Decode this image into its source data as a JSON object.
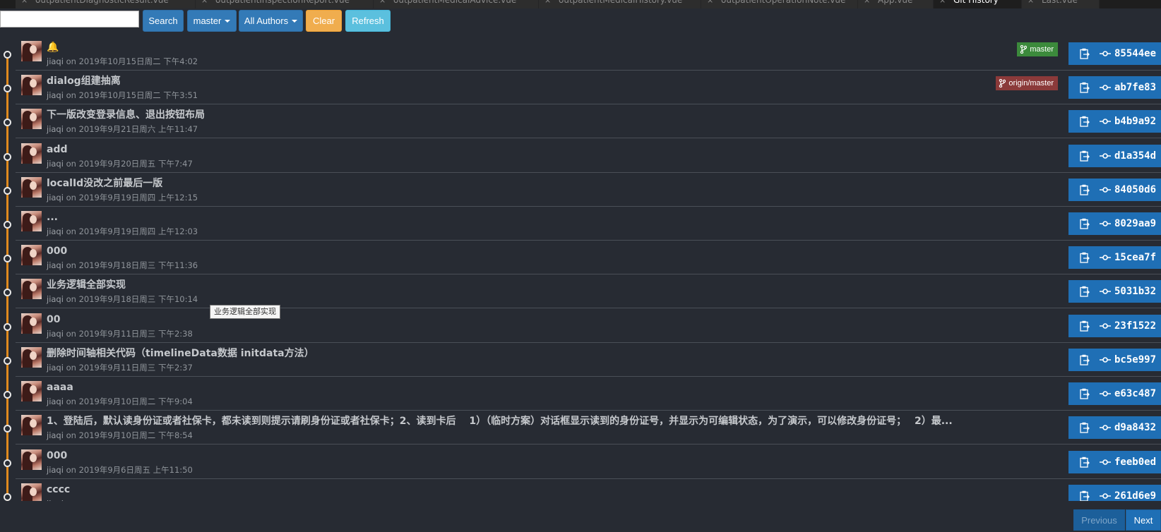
{
  "tabs": [
    {
      "label": "outpatientDiagnosticResult.vue",
      "active": false
    },
    {
      "label": "outpatientInspectionReport.vue",
      "active": false
    },
    {
      "label": "outpatientMedicalAdvice.vue",
      "active": false
    },
    {
      "label": "outpatientMedicalHistory.vue",
      "active": false
    },
    {
      "label": "outpatientOperationNote.vue",
      "active": false
    },
    {
      "label": "App.vue",
      "active": false
    },
    {
      "label": "Git History",
      "active": true
    },
    {
      "label": "Last.vue",
      "active": false
    }
  ],
  "toolbar": {
    "search_value": "",
    "search_label": "Search",
    "branch_label": "master",
    "authors_label": "All Authors",
    "clear_label": "Clear",
    "refresh_label": "Refresh"
  },
  "commits": [
    {
      "subject": "🔔",
      "author": "jiaqi",
      "on": "on",
      "date": "2019年10月15日周二 下午4:02",
      "sha": "85544ee",
      "branch": "master",
      "branch_color": "#3c8a3c"
    },
    {
      "subject": "dialog组建抽离",
      "author": "jiaqi",
      "on": "on",
      "date": "2019年10月15日周二 下午3:51",
      "sha": "ab7fe83",
      "branch": "origin/master",
      "branch_color": "#8b3a3a"
    },
    {
      "subject": "下一版改变登录信息、退出按钮布局",
      "author": "jiaqi",
      "on": "on",
      "date": "2019年9月21日周六 上午11:47",
      "sha": "b4b9a92"
    },
    {
      "subject": "add",
      "author": "jiaqi",
      "on": "on",
      "date": "2019年9月20日周五 下午7:47",
      "sha": "d1a354d"
    },
    {
      "subject": "localId没改之前最后一版",
      "author": "jiaqi",
      "on": "on",
      "date": "2019年9月19日周四 上午12:15",
      "sha": "84050d6"
    },
    {
      "subject": "...",
      "author": "jiaqi",
      "on": "on",
      "date": "2019年9月19日周四 上午12:03",
      "sha": "8029aa9"
    },
    {
      "subject": "000",
      "author": "jiaqi",
      "on": "on",
      "date": "2019年9月18日周三 下午11:36",
      "sha": "15cea7f"
    },
    {
      "subject": "业务逻辑全部实现",
      "author": "jiaqi",
      "on": "on",
      "date": "2019年9月18日周三 下午10:14",
      "sha": "5031b32"
    },
    {
      "subject": "00",
      "author": "jiaqi",
      "on": "on",
      "date": "2019年9月11日周三 下午2:38",
      "sha": "23f1522"
    },
    {
      "subject": "删除时间轴相关代码（timelineData数据 initdata方法）",
      "author": "jiaqi",
      "on": "on",
      "date": "2019年9月11日周三 下午2:37",
      "sha": "bc5e997"
    },
    {
      "subject": "aaaa",
      "author": "jiaqi",
      "on": "on",
      "date": "2019年9月10日周二 下午9:04",
      "sha": "e63c487"
    },
    {
      "subject": "1、登陆后，默认读身份证或者社保卡，都未读到则提示请刷身份证或者社保卡；2、读到卡后　 1）（临时方案）对话框显示读到的身份证号，并显示为可编辑状态，为了演示，可以修改身份证号；　 2）最...",
      "author": "jiaqi",
      "on": "on",
      "date": "2019年9月10日周二 下午8:54",
      "sha": "d9a8432"
    },
    {
      "subject": "000",
      "author": "jiaqi",
      "on": "on",
      "date": "2019年9月6日周五 上午11:50",
      "sha": "feeb0ed"
    },
    {
      "subject": "cccc",
      "author": "jiaqi",
      "on": "on",
      "date": "",
      "sha": "261d6e9"
    }
  ],
  "tooltip": "业务逻辑全部实现",
  "pagination": {
    "previous_label": "Previous",
    "next_label": "Next"
  },
  "icons": {
    "branch": "git-branch-icon",
    "copy": "clipboard-copy-icon",
    "commit": "git-commit-icon"
  },
  "colors": {
    "graph_line": "#e08a1e",
    "sha_button": "#1f6fb5",
    "background": "#272b33"
  }
}
